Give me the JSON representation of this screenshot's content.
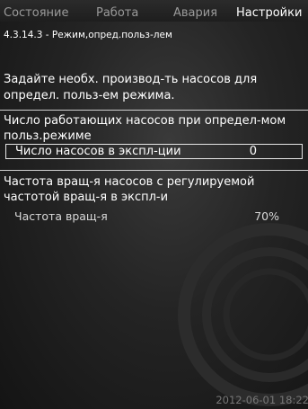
{
  "tabs": [
    {
      "label": "Состояние",
      "active": false
    },
    {
      "label": "Работа",
      "active": false
    },
    {
      "label": "Авария",
      "active": false
    },
    {
      "label": "Настройки",
      "active": true
    }
  ],
  "breadcrumb": "4.3.14.3 - Режим,опред.польз-лем",
  "intro": [
    "Задайте необх. производ-ть насосов для",
    "определ. польз-ем режима."
  ],
  "section1": {
    "heading": [
      "Число работающих насосов при определ-мом",
      "польз.режиме"
    ],
    "field_label": "Число насосов в экспл-ции",
    "field_value": "0"
  },
  "section2": {
    "heading": [
      "Частота вращ-я насосов с регулируемой",
      "частотой вращ-я в экспл-и"
    ],
    "field_label": "Частота вращ-я",
    "field_value": "70%"
  },
  "timestamp": "2012-06-01 18:22",
  "colors": {
    "background": "#1a1a1a",
    "text": "#ffffff",
    "inactive_tab": "#9a9a9a",
    "timestamp": "#777777"
  }
}
